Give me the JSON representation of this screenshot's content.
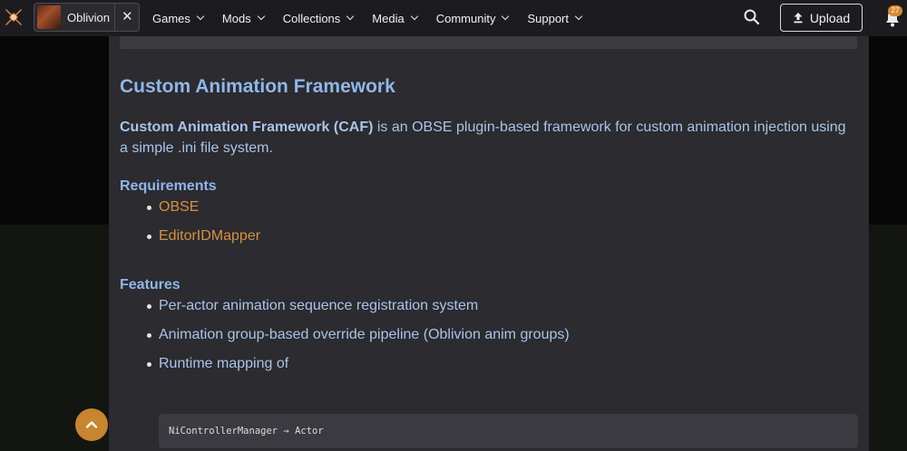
{
  "header": {
    "game": {
      "name": "Oblivion"
    },
    "nav": [
      {
        "label": "Games"
      },
      {
        "label": "Mods"
      },
      {
        "label": "Collections"
      },
      {
        "label": "Media"
      },
      {
        "label": "Community"
      },
      {
        "label": "Support"
      }
    ],
    "upload_label": "Upload",
    "notification_count": "27"
  },
  "article": {
    "title": "Custom Animation Framework",
    "intro_bold": "Custom Animation Framework (CAF)",
    "intro_rest": " is an OBSE plugin-based framework for custom animation injection using a simple .ini file system.",
    "requirements_heading": "Requirements",
    "requirements": [
      "OBSE",
      "EditorIDMapper"
    ],
    "features_heading": "Features",
    "features": [
      "Per-actor animation sequence registration system",
      "Animation group-based override pipeline (Oblivion anim groups)",
      "Runtime mapping of"
    ],
    "code": "NiControllerManager → Actor"
  },
  "colors": {
    "accent": "#d98a2c",
    "heading": "#8fb7e8",
    "body_text": "#a9c4e6",
    "link": "#d8903e",
    "panel": "#2b2b30"
  },
  "icons": [
    "app-logo-icon",
    "close-icon",
    "chevron-down-icon",
    "search-icon",
    "upload-icon",
    "bell-icon",
    "arrow-up-icon"
  ]
}
